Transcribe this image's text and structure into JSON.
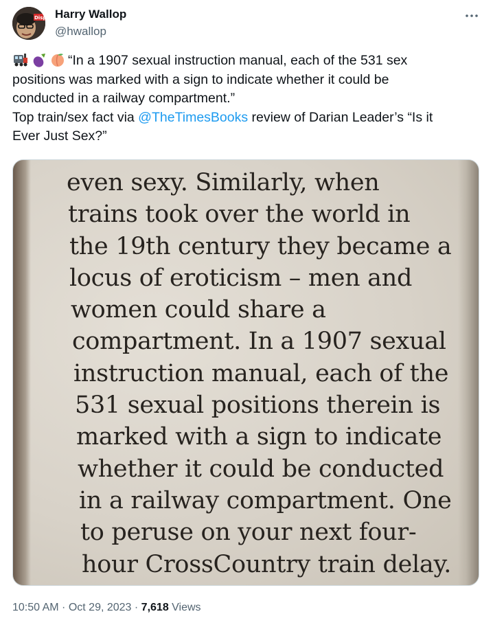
{
  "author": {
    "name": "Harry Wallop",
    "handle": "@hwallop",
    "avatar_badge": "Disp"
  },
  "menu": {
    "icon": "more-horizontal-icon"
  },
  "tweet": {
    "emojis": [
      "train-emoji",
      "eggplant-emoji",
      "peach-emoji"
    ],
    "line1": "“In a 1907 sexual instruction manual, each of the 531 sex",
    "line2": "positions was marked with a sign to indicate whether it could be",
    "line3": "conducted in a railway compartment.”",
    "line4_before": "Top train/sex fact via ",
    "mention": "@TheTimesBooks",
    "line4_after": " review of Darian Leader’s “Is it",
    "line5": "Ever Just Sex?”"
  },
  "photo": {
    "lines": [
      "even sexy. Similarly, when",
      "trains took over the world in",
      "the 19th century they became a",
      "locus of eroticism – men and",
      "women could share a",
      "compartment. In a 1907 sexual",
      "instruction manual, each of the",
      "531 sexual positions therein is",
      "marked with a sign to indicate",
      "whether it could be conducted",
      "in a railway compartment. One",
      "to peruse on your next four-",
      "hour CrossCountry train delay."
    ]
  },
  "meta": {
    "time": "10:50 AM",
    "separator": " · ",
    "date": "Oct 29, 2023",
    "views_count": "7,618",
    "views_label": " Views"
  },
  "colors": {
    "text": "#0f1419",
    "secondary": "#536471",
    "link": "#1d9bf0"
  }
}
